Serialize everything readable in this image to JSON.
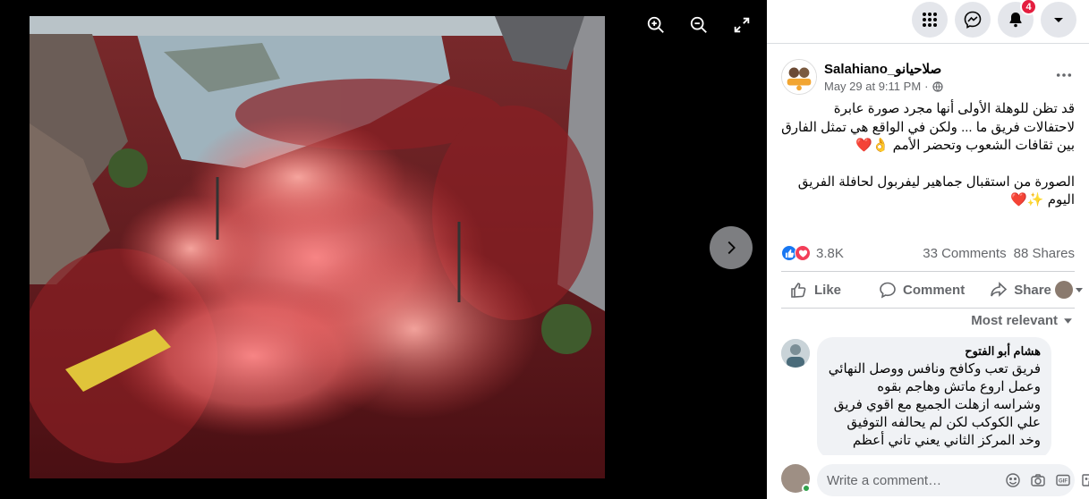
{
  "viewer": {
    "tools": [
      {
        "icon": "zoom-in-icon"
      },
      {
        "icon": "zoom-out-icon"
      },
      {
        "icon": "fullscreen-icon"
      }
    ],
    "next_icon": "chevron-right-icon"
  },
  "topnav": {
    "menu_icon": "grid-menu-icon",
    "messenger_icon": "messenger-icon",
    "notifications_icon": "bell-icon",
    "notifications_count": "4",
    "account_icon": "caret-down-icon"
  },
  "post": {
    "page_name": "Salahiano_صلاحيانو",
    "date": "May 29 at 9:11 PM",
    "privacy_icon": "globe-icon",
    "paragraphs": [
      "قد تظن للوهلة الأولى أنها مجرد صورة عابرة لاحتفالات فريق ما ... ولكن في الواقع هي تمثل الفارق بين ثقافات الشعوب وتحضر الأمم 👌❤️",
      "الصورة من استقبال جماهير ليفربول لحافلة الفريق اليوم ✨❤️"
    ],
    "reactions_count": "3.8K",
    "comments_count": "33 Comments",
    "shares_count": "88 Shares"
  },
  "actions": {
    "like": "Like",
    "comment": "Comment",
    "share": "Share"
  },
  "sort_label": "Most relevant",
  "comment": {
    "author": "هشام أبو الفتوح",
    "text": "فريق تعب وكافح ونافس ووصل النهائي وعمل اروع ماتش وهاجم بقوه وشراسه ازهلت الجميع مع اقوي فريق علي الكوكب لكن لم يحالفه التوفيق وخد المركز الثاني يعني تاني أعظم"
  },
  "write_comment": {
    "placeholder": "Write a comment…"
  },
  "colors": {
    "accent": "#1877f2",
    "love": "#f33e58",
    "badge": "#e41e3f"
  }
}
